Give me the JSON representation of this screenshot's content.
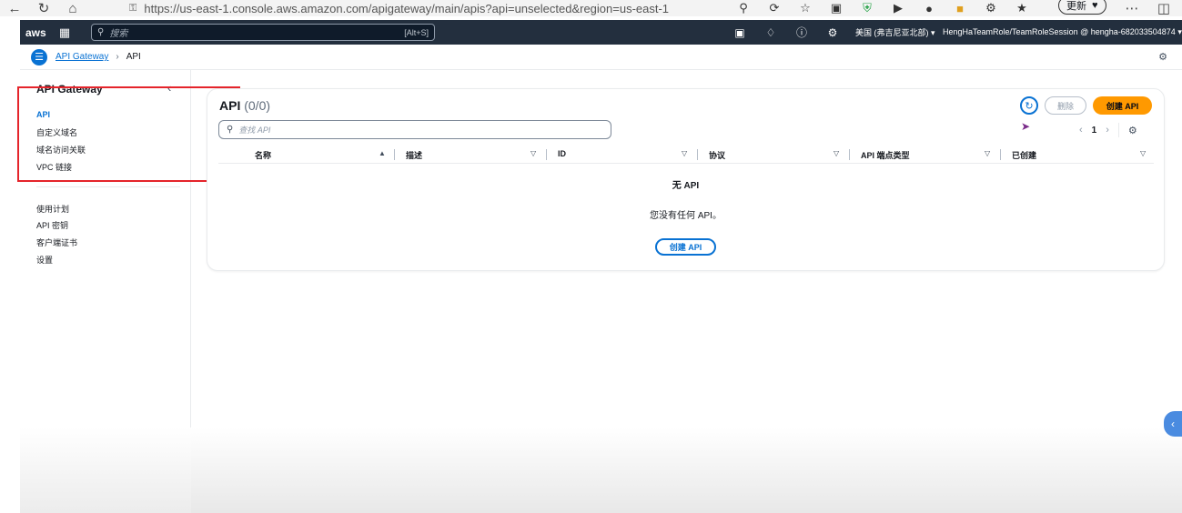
{
  "browser": {
    "url": "https://us-east-1.console.aws.amazon.com/apigateway/main/apis?api=unselected&region=us-east-1",
    "update_label": "更新"
  },
  "topnav": {
    "logo": "aws",
    "search_placeholder": "搜索",
    "search_shortcut": "[Alt+S]",
    "region": "美国 (弗吉尼亚北部)",
    "account": "HengHaTeamRole/TeamRoleSession @ hengha-682033504874"
  },
  "breadcrumb": {
    "root": "API Gateway",
    "current": "API"
  },
  "sidebar": {
    "title": "API Gateway",
    "items_primary": [
      {
        "label": "API",
        "active": true
      },
      {
        "label": "自定义域名",
        "active": false
      },
      {
        "label": "域名访问关联",
        "active": false
      },
      {
        "label": "VPC 链接",
        "active": false
      }
    ],
    "items_secondary": [
      {
        "label": "使用计划"
      },
      {
        "label": "API 密钥"
      },
      {
        "label": "客户端证书"
      },
      {
        "label": "设置"
      }
    ]
  },
  "panel": {
    "title": "API",
    "count": "(0/0)",
    "delete_label": "删除",
    "create_label": "创建 API",
    "search_placeholder": "查找 API",
    "page": "1",
    "columns": [
      "名称",
      "描述",
      "ID",
      "协议",
      "API 端点类型",
      "已创建"
    ],
    "empty_title": "无 API",
    "empty_desc": "您没有任何 API。",
    "empty_create_label": "创建 API"
  },
  "colors": {
    "accent": "#0972d3",
    "primary_button": "#ff9900",
    "nav_bg": "#232f3e",
    "highlight": "#e5242b"
  }
}
